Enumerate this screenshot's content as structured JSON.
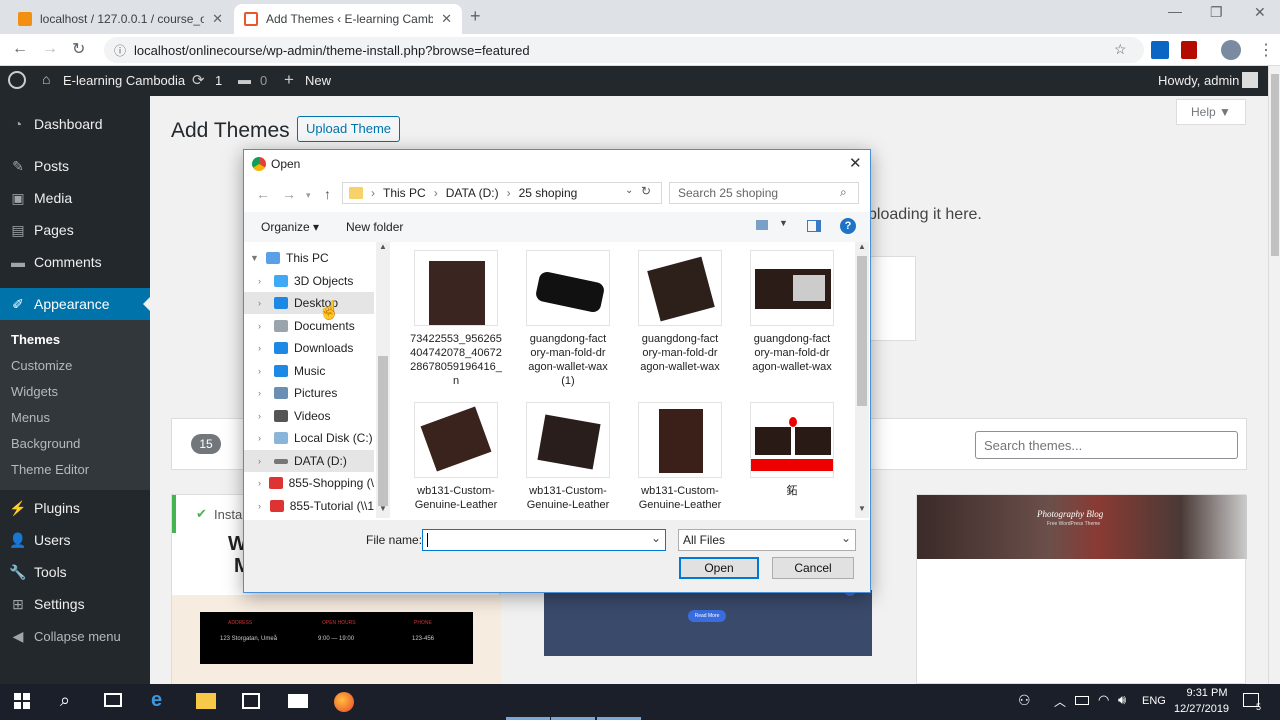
{
  "browser": {
    "tabs": [
      {
        "title": "localhost / 127.0.0.1 / course_onl",
        "active": false
      },
      {
        "title": "Add Themes ‹ E-learning Cambodia",
        "active": true
      }
    ],
    "new_tab": "+",
    "url": "localhost/onlinecourse/wp-admin/theme-install.php?browse=featured"
  },
  "adminbar": {
    "site_name": "E-learning Cambodia",
    "updates": "1",
    "comments": "0",
    "new_label": "New",
    "howdy": "Howdy, admin"
  },
  "sidebar": {
    "items": [
      {
        "label": "Dashboard",
        "icon": "dashboard-icon"
      },
      {
        "label": "Posts",
        "icon": "pin-icon"
      },
      {
        "label": "Media",
        "icon": "media-icon"
      },
      {
        "label": "Pages",
        "icon": "pages-icon"
      },
      {
        "label": "Comments",
        "icon": "comment-icon"
      },
      {
        "label": "Appearance",
        "icon": "brush-icon"
      },
      {
        "label": "Plugins",
        "icon": "plugin-icon"
      },
      {
        "label": "Users",
        "icon": "users-icon"
      },
      {
        "label": "Tools",
        "icon": "tools-icon"
      },
      {
        "label": "Settings",
        "icon": "settings-icon"
      },
      {
        "label": "Collapse menu",
        "icon": "collapse-icon"
      }
    ],
    "submenu": [
      "Themes",
      "Customize",
      "Widgets",
      "Menus",
      "Background",
      "Theme Editor"
    ]
  },
  "main": {
    "title": "Add Themes",
    "upload_button": "Upload Theme",
    "help": "Help ▼",
    "upload_hint": "ploading it here.",
    "count": "15",
    "search_placeholder": "Search themes...",
    "installed_label": "Instal",
    "card_text_1": "W",
    "card_text_2": "M",
    "blog_title": "Photography Blog",
    "blog_sub": "Free WordPress Theme",
    "footer_cols": [
      "ADDRESS",
      "OPEN HOURS",
      "PHONE"
    ],
    "footer_vals": [
      "123 Storgatan, Umeå",
      "9:00 — 19:00",
      "123-456"
    ],
    "read_more": "Read More"
  },
  "dialog": {
    "title": "Open",
    "breadcrumb": [
      "This PC",
      "DATA (D:)",
      "25 shoping"
    ],
    "search_placeholder": "Search 25 shoping",
    "organize": "Organize ▾",
    "new_folder": "New folder",
    "tree": [
      {
        "label": "This PC",
        "icon": "pc-icon",
        "color": "#5aa0e6"
      },
      {
        "label": "3D Objects",
        "icon": "cube-icon",
        "color": "#3fa9f5"
      },
      {
        "label": "Desktop",
        "icon": "desktop-icon",
        "color": "#1e88e5"
      },
      {
        "label": "Documents",
        "icon": "document-icon",
        "color": "#9aa4ad"
      },
      {
        "label": "Downloads",
        "icon": "download-icon",
        "color": "#1e88e5"
      },
      {
        "label": "Music",
        "icon": "music-icon",
        "color": "#1e88e5"
      },
      {
        "label": "Pictures",
        "icon": "pictures-icon",
        "color": "#6b8fb3"
      },
      {
        "label": "Videos",
        "icon": "video-icon",
        "color": "#555"
      },
      {
        "label": "Local Disk (C:)",
        "icon": "disk-icon",
        "color": "#8ab4d8"
      },
      {
        "label": "DATA (D:)",
        "icon": "drive-icon",
        "color": "#777"
      },
      {
        "label": "855-Shopping (\\",
        "icon": "network-drive-icon",
        "color": "#d33"
      },
      {
        "label": "855-Tutorial (\\\\1",
        "icon": "network-drive-icon",
        "color": "#d33"
      }
    ],
    "files": [
      {
        "name": "73422553_956265404742078_4067228678059196416_n",
        "lines": [
          "73422553_956265",
          "404742078_40672",
          "28678059196416_",
          "n"
        ]
      },
      {
        "name": "guangdong-factory-man-fold-dragon-wallet-wax (1)",
        "lines": [
          "guangdong-fact",
          "ory-man-fold-dr",
          "agon-wallet-wax",
          "(1)"
        ]
      },
      {
        "name": "guangdong-factory-man-fold-dragon-wallet-wax",
        "lines": [
          "guangdong-fact",
          "ory-man-fold-dr",
          "agon-wallet-wax"
        ]
      },
      {
        "name": "guangdong-factory-man-fold-dragon-wallet-wax",
        "lines": [
          "guangdong-fact",
          "ory-man-fold-dr",
          "agon-wallet-wax"
        ]
      },
      {
        "name": "wb131-Custom-Genuine-Leather",
        "lines": [
          "wb131-Custom-",
          "Genuine-Leather"
        ]
      },
      {
        "name": "wb131-Custom-Genuine-Leather",
        "lines": [
          "wb131-Custom-",
          "Genuine-Leather"
        ]
      },
      {
        "name": "wb131-Custom-Genuine-Leather",
        "lines": [
          "wb131-Custom-",
          "Genuine-Leather"
        ]
      },
      {
        "name": "",
        "lines": [
          "鉐"
        ]
      }
    ],
    "filename_label": "File name:",
    "filename_value": "",
    "filetype": "All Files",
    "open_button": "Open",
    "cancel_button": "Cancel"
  },
  "taskbar": {
    "lang": "ENG",
    "time": "9:31 PM",
    "date": "12/27/2019",
    "notifications": "5"
  },
  "colors": {
    "wp_dark": "#23282d",
    "wp_blue": "#0073aa",
    "dialog_border": "#4a90d9"
  }
}
